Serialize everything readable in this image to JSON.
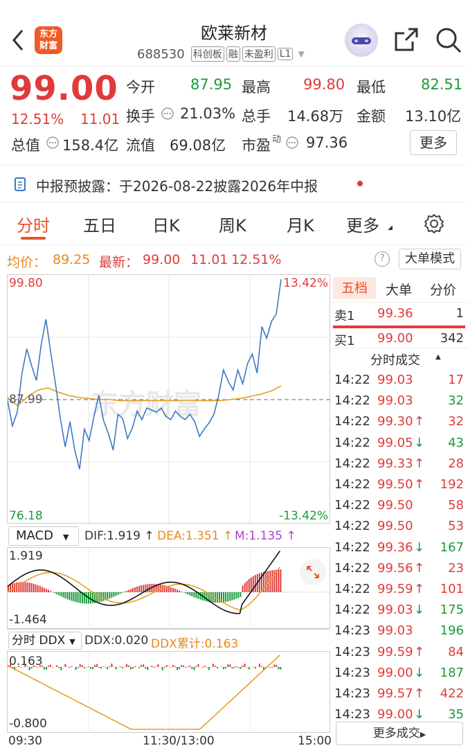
{
  "header": {
    "logo_text_line1": "东方",
    "logo_text_line2": "财富",
    "stock_name": "欧莱新材",
    "stock_code": "688530",
    "tags": [
      "科创板",
      "融",
      "未盈利",
      "L1"
    ]
  },
  "quote": {
    "price": "99.00",
    "change_pct": "12.51%",
    "change_amt": "11.01",
    "open_label": "今开",
    "open": "87.95",
    "high_label": "最高",
    "high": "99.80",
    "low_label": "最低",
    "low": "82.51",
    "turnover_label": "换手",
    "turnover": "21.03%",
    "volume_label": "总手",
    "volume": "14.68万",
    "amount_label": "金额",
    "amount": "13.10亿",
    "mktcap_label": "总值",
    "mktcap": "158.4亿",
    "float_label": "流值",
    "float_cap": "69.08亿",
    "pe_label": "市盈",
    "pe_sup": "动",
    "pe": "97.36",
    "more_button": "更多"
  },
  "notice": {
    "text": "中报预披露：于2026-08-22披露2026年中报"
  },
  "tabs": [
    "分时",
    "五日",
    "日K",
    "周K",
    "月K",
    "更多"
  ],
  "ohlc_line": {
    "avg_label": "均价：",
    "avg": "89.25",
    "latest_label": "最新：",
    "latest": "99.00",
    "change": "11.01",
    "change_pct": "12.51%",
    "mode_button": "大单模式",
    "help": "?"
  },
  "chart": {
    "y_top": "99.80",
    "y_mid": "87.99",
    "y_bottom": "76.18",
    "pct_top": "13.42%",
    "pct_bottom": "-13.42%",
    "watermark": "东方财富",
    "times": [
      "09:30",
      "11:30/13:00",
      "15:00"
    ]
  },
  "chart_data": {
    "type": "line",
    "title": "",
    "xlabel": "",
    "ylabel": "",
    "ylim": [
      76.18,
      99.8
    ],
    "series": [
      {
        "name": "",
        "values": [
          87.9,
          85.5,
          86.8,
          90.5,
          92.8,
          91.2,
          89.8,
          93.2,
          95.6,
          92.4,
          89.4,
          86.2,
          83.5,
          85.9,
          83.2,
          81.4,
          85.2,
          84.1,
          86.4,
          88.4,
          86.0,
          84.8,
          83.2,
          86.6,
          86.2,
          84.3,
          85.3,
          86.9,
          86.1,
          87.2,
          87.0,
          86.8,
          87.2,
          86.4,
          86.1,
          86.9,
          86.4,
          86.1,
          86.6,
          85.9,
          84.5,
          85.2,
          85.8,
          86.6,
          88.4,
          90.8,
          89.7,
          88.9,
          90.8,
          89.5,
          91.4,
          92.3,
          90.5,
          94.9,
          93.8,
          95.4,
          96.1,
          99.4
        ]
      },
      {
        "name": "",
        "values": [
          88.2,
          87.4,
          88.3,
          88.9,
          89.1,
          88.7,
          88.4,
          88.2,
          88.1,
          88.0,
          88.0,
          87.9,
          87.9,
          87.9,
          87.9,
          87.9,
          87.9,
          87.9,
          87.9,
          87.9,
          87.9,
          87.9,
          88.0,
          88.1,
          88.3,
          88.5,
          88.8,
          89.3
        ]
      }
    ]
  },
  "orderbook": {
    "tabs": [
      "五档",
      "大单",
      "分价"
    ],
    "sell1_label": "卖1",
    "sell1_price": "99.36",
    "sell1_vol": "1",
    "buy1_label": "买1",
    "buy1_price": "99.00",
    "buy1_vol": "342",
    "trades_title": "分时成交",
    "more_trades": "更多成交",
    "trades": [
      {
        "time": "14:22",
        "price": "99.03",
        "arrow": "",
        "vol": "17",
        "pc": "red",
        "vc": "red"
      },
      {
        "time": "14:22",
        "price": "99.03",
        "arrow": "",
        "vol": "32",
        "pc": "red",
        "vc": "green"
      },
      {
        "time": "14:22",
        "price": "99.30",
        "arrow": "↑",
        "vol": "32",
        "pc": "red",
        "vc": "red"
      },
      {
        "time": "14:22",
        "price": "99.05",
        "arrow": "↓",
        "vol": "43",
        "pc": "red",
        "vc": "green"
      },
      {
        "time": "14:22",
        "price": "99.33",
        "arrow": "↑",
        "vol": "28",
        "pc": "red",
        "vc": "red"
      },
      {
        "time": "14:22",
        "price": "99.50",
        "arrow": "↑",
        "vol": "192",
        "pc": "red",
        "vc": "red"
      },
      {
        "time": "14:22",
        "price": "99.50",
        "arrow": "",
        "vol": "58",
        "pc": "red",
        "vc": "red"
      },
      {
        "time": "14:22",
        "price": "99.50",
        "arrow": "",
        "vol": "53",
        "pc": "red",
        "vc": "red"
      },
      {
        "time": "14:22",
        "price": "99.36",
        "arrow": "↓",
        "vol": "167",
        "pc": "red",
        "vc": "green"
      },
      {
        "time": "14:22",
        "price": "99.56",
        "arrow": "↑",
        "vol": "23",
        "pc": "red",
        "vc": "red"
      },
      {
        "time": "14:22",
        "price": "99.59",
        "arrow": "↑",
        "vol": "101",
        "pc": "red",
        "vc": "red"
      },
      {
        "time": "14:22",
        "price": "99.03",
        "arrow": "↓",
        "vol": "175",
        "pc": "red",
        "vc": "green"
      },
      {
        "time": "14:23",
        "price": "99.03",
        "arrow": "",
        "vol": "196",
        "pc": "red",
        "vc": "green"
      },
      {
        "time": "14:23",
        "price": "99.59",
        "arrow": "↑",
        "vol": "84",
        "pc": "red",
        "vc": "red"
      },
      {
        "time": "14:23",
        "price": "99.00",
        "arrow": "↓",
        "vol": "187",
        "pc": "red",
        "vc": "green"
      },
      {
        "time": "14:23",
        "price": "99.57",
        "arrow": "↑",
        "vol": "422",
        "pc": "red",
        "vc": "red"
      },
      {
        "time": "14:23",
        "price": "99.00",
        "arrow": "↓",
        "vol": "35",
        "pc": "red",
        "vc": "green"
      }
    ]
  },
  "macd": {
    "selector": "MACD",
    "dif": "DIF:1.919 ↑",
    "dea": "DEA:1.351 ↑",
    "m": "M:1.135 ↑",
    "y_top": "1.919",
    "y_bottom": "-1.464"
  },
  "ddx": {
    "selector": "分时 DDX",
    "ddx": "DDX:0.020",
    "ddx_sum": "DDX累计:0.163",
    "y_top": "0.163",
    "y_bottom": "-0.800"
  },
  "colors": {
    "up": "#e03a3a",
    "down": "#1a9a3a",
    "accent": "#e8522a",
    "price_line": "#3b78c4",
    "avg_line": "#e8a020"
  }
}
